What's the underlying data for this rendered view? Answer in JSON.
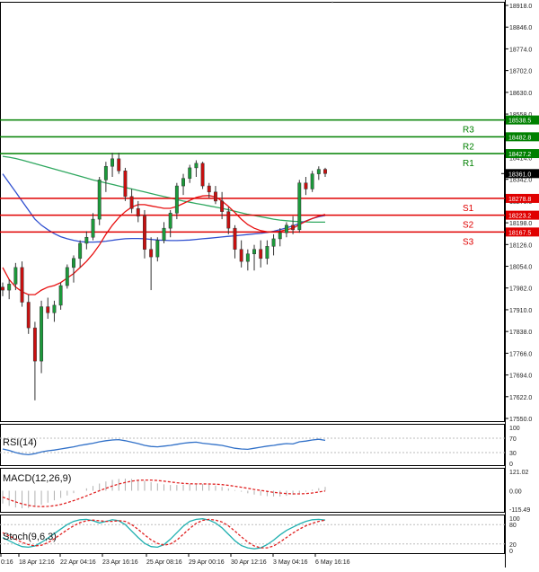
{
  "chart_data": {
    "type": "candlestick",
    "price_axis": {
      "ticks": [
        "18918.0",
        "18846.0",
        "18774.0",
        "18702.0",
        "18630.0",
        "18558.0",
        "18486.0",
        "18414.0",
        "18342.0",
        "18270.0",
        "18198.0",
        "18126.0",
        "18054.0",
        "17982.0",
        "17910.0",
        "17838.0",
        "17766.0",
        "17694.0",
        "17622.0",
        "17550.0"
      ],
      "tick_values": [
        18918,
        18846,
        18774,
        18702,
        18630,
        18558,
        18486,
        18414,
        18342,
        18270,
        18198,
        18126,
        18054,
        17982,
        17910,
        17838,
        17766,
        17694,
        17622,
        17550
      ],
      "range": [
        17550,
        18918
      ]
    },
    "time_axis": {
      "labels": [
        "0:16",
        "18 Apr 12:16",
        "22 Apr 04:16",
        "23 Apr 16:16",
        "25 Apr 08:16",
        "29 Apr 00:16",
        "30 Apr 12:16",
        "3 May 04:16",
        "6 May 16:16"
      ]
    },
    "levels": [
      {
        "name": "R3",
        "value": 18538.5,
        "label": "18538.5",
        "color": "#008000"
      },
      {
        "name": "R2",
        "value": 18482.8,
        "label": "18482.8",
        "color": "#008000"
      },
      {
        "name": "R1",
        "value": 18427.2,
        "label": "18427.2",
        "color": "#008000"
      },
      {
        "name": "S1",
        "value": 18278.8,
        "label": "18278.8",
        "color": "#e00000"
      },
      {
        "name": "S2",
        "value": 18223.2,
        "label": "18223.2",
        "color": "#e00000"
      },
      {
        "name": "S3",
        "value": 18167.5,
        "label": "18167.5",
        "color": "#e00000"
      }
    ],
    "current_price": {
      "value": 18361.0,
      "label": "18361.0"
    },
    "candles": [
      {
        "o": 17985,
        "h": 18000,
        "l": 17955,
        "c": 17975
      },
      {
        "o": 17975,
        "h": 18010,
        "l": 17945,
        "c": 17995
      },
      {
        "o": 17995,
        "h": 18065,
        "l": 17975,
        "c": 18050
      },
      {
        "o": 18050,
        "h": 18070,
        "l": 17920,
        "c": 17935
      },
      {
        "o": 17935,
        "h": 17960,
        "l": 17830,
        "c": 17850
      },
      {
        "o": 17850,
        "h": 17870,
        "l": 17610,
        "c": 17740
      },
      {
        "o": 17740,
        "h": 17940,
        "l": 17700,
        "c": 17920
      },
      {
        "o": 17920,
        "h": 17950,
        "l": 17880,
        "c": 17900
      },
      {
        "o": 17900,
        "h": 17940,
        "l": 17870,
        "c": 17925
      },
      {
        "o": 17925,
        "h": 18000,
        "l": 17910,
        "c": 17990
      },
      {
        "o": 17990,
        "h": 18060,
        "l": 17980,
        "c": 18050
      },
      {
        "o": 18050,
        "h": 18090,
        "l": 18000,
        "c": 18080
      },
      {
        "o": 18080,
        "h": 18140,
        "l": 18050,
        "c": 18130
      },
      {
        "o": 18130,
        "h": 18170,
        "l": 18110,
        "c": 18150
      },
      {
        "o": 18150,
        "h": 18230,
        "l": 18140,
        "c": 18210
      },
      {
        "o": 18210,
        "h": 18350,
        "l": 18190,
        "c": 18340
      },
      {
        "o": 18340,
        "h": 18400,
        "l": 18300,
        "c": 18385
      },
      {
        "o": 18385,
        "h": 18430,
        "l": 18350,
        "c": 18410
      },
      {
        "o": 18410,
        "h": 18430,
        "l": 18360,
        "c": 18370
      },
      {
        "o": 18370,
        "h": 18380,
        "l": 18270,
        "c": 18285
      },
      {
        "o": 18285,
        "h": 18310,
        "l": 18230,
        "c": 18245
      },
      {
        "o": 18245,
        "h": 18270,
        "l": 18200,
        "c": 18220
      },
      {
        "o": 18220,
        "h": 18240,
        "l": 18080,
        "c": 18110
      },
      {
        "o": 18110,
        "h": 18150,
        "l": 17975,
        "c": 18085
      },
      {
        "o": 18085,
        "h": 18150,
        "l": 18070,
        "c": 18140
      },
      {
        "o": 18140,
        "h": 18200,
        "l": 18130,
        "c": 18180
      },
      {
        "o": 18180,
        "h": 18240,
        "l": 18150,
        "c": 18230
      },
      {
        "o": 18230,
        "h": 18330,
        "l": 18210,
        "c": 18320
      },
      {
        "o": 18320,
        "h": 18360,
        "l": 18290,
        "c": 18345
      },
      {
        "o": 18345,
        "h": 18390,
        "l": 18330,
        "c": 18380
      },
      {
        "o": 18380,
        "h": 18405,
        "l": 18350,
        "c": 18395
      },
      {
        "o": 18395,
        "h": 18400,
        "l": 18310,
        "c": 18320
      },
      {
        "o": 18320,
        "h": 18330,
        "l": 18280,
        "c": 18300
      },
      {
        "o": 18300,
        "h": 18320,
        "l": 18260,
        "c": 18270
      },
      {
        "o": 18270,
        "h": 18300,
        "l": 18210,
        "c": 18235
      },
      {
        "o": 18235,
        "h": 18250,
        "l": 18160,
        "c": 18180
      },
      {
        "o": 18180,
        "h": 18190,
        "l": 18080,
        "c": 18110
      },
      {
        "o": 18110,
        "h": 18140,
        "l": 18050,
        "c": 18070
      },
      {
        "o": 18070,
        "h": 18110,
        "l": 18040,
        "c": 18095
      },
      {
        "o": 18095,
        "h": 18125,
        "l": 18040,
        "c": 18110
      },
      {
        "o": 18110,
        "h": 18140,
        "l": 18050,
        "c": 18080
      },
      {
        "o": 18080,
        "h": 18140,
        "l": 18060,
        "c": 18120
      },
      {
        "o": 18120,
        "h": 18160,
        "l": 18090,
        "c": 18145
      },
      {
        "o": 18145,
        "h": 18180,
        "l": 18120,
        "c": 18165
      },
      {
        "o": 18165,
        "h": 18200,
        "l": 18150,
        "c": 18190
      },
      {
        "o": 18190,
        "h": 18220,
        "l": 18160,
        "c": 18175
      },
      {
        "o": 18175,
        "h": 18340,
        "l": 18165,
        "c": 18330
      },
      {
        "o": 18330,
        "h": 18350,
        "l": 18290,
        "c": 18310
      },
      {
        "o": 18310,
        "h": 18370,
        "l": 18300,
        "c": 18360
      },
      {
        "o": 18360,
        "h": 18385,
        "l": 18340,
        "c": 18375
      },
      {
        "o": 18375,
        "h": 18380,
        "l": 18350,
        "c": 18361
      }
    ],
    "ma_fast": {
      "color": "#e81010",
      "values": [
        18050,
        18010,
        17985,
        17970,
        17960,
        17960,
        17975,
        17985,
        17990,
        18000,
        18015,
        18030,
        18050,
        18070,
        18095,
        18125,
        18160,
        18190,
        18215,
        18235,
        18250,
        18258,
        18258,
        18254,
        18250,
        18246,
        18246,
        18252,
        18262,
        18272,
        18282,
        18287,
        18288,
        18284,
        18270,
        18252,
        18232,
        18210,
        18192,
        18180,
        18172,
        18168,
        18168,
        18170,
        18175,
        18180,
        18192,
        18203,
        18212,
        18220,
        18226
      ]
    },
    "ma_mid": {
      "color": "#3050d0",
      "values": [
        18360,
        18330,
        18300,
        18270,
        18240,
        18210,
        18190,
        18175,
        18162,
        18152,
        18145,
        18140,
        18136,
        18134,
        18134,
        18135,
        18137,
        18140,
        18143,
        18145,
        18146,
        18146,
        18145,
        18143,
        18141,
        18140,
        18139,
        18139,
        18140,
        18141,
        18143,
        18145,
        18147,
        18149,
        18151,
        18153,
        18155,
        18157,
        18159,
        18161,
        18163,
        18166,
        18170,
        18175,
        18181,
        18188,
        18196,
        18204,
        18212,
        18218,
        18222
      ]
    },
    "ma_slow": {
      "color": "#30a860",
      "values": [
        18418,
        18415,
        18411,
        18406,
        18400,
        18394,
        18388,
        18382,
        18376,
        18370,
        18364,
        18358,
        18352,
        18346,
        18340,
        18335,
        18330,
        18325,
        18320,
        18315,
        18310,
        18305,
        18300,
        18295,
        18290,
        18285,
        18280,
        18275,
        18270,
        18266,
        18262,
        18258,
        18254,
        18250,
        18246,
        18241,
        18236,
        18231,
        18226,
        18222,
        18218,
        18214,
        18210,
        18207,
        18205,
        18203,
        18202,
        18201,
        18200,
        18200,
        18200
      ]
    },
    "rsi": {
      "label": "RSI(14)",
      "ticks": [
        "100",
        "70",
        "30",
        "0"
      ],
      "tick_values": [
        100,
        70,
        30,
        0
      ],
      "color": "#3070c8",
      "values": [
        40,
        36,
        30,
        26,
        24,
        27,
        32,
        35,
        37,
        40,
        43,
        46,
        50,
        53,
        56,
        60,
        63,
        65,
        66,
        63,
        59,
        55,
        50,
        47,
        46,
        48,
        50,
        53,
        56,
        58,
        59,
        56,
        54,
        52,
        50,
        46,
        42,
        40,
        39,
        42,
        45,
        48,
        50,
        53,
        55,
        54,
        60,
        62,
        65,
        67,
        64
      ]
    },
    "macd": {
      "label": "MACD(12,26,9)",
      "ticks": [
        "121.02",
        "0.00",
        "-115.49"
      ],
      "tick_values": [
        121.02,
        0,
        -115.49
      ],
      "hist_color": "#b0b0b0",
      "signal_color": "#e02020",
      "hist": [
        -80,
        -95,
        -105,
        -110,
        -108,
        -100,
        -88,
        -75,
        -60,
        -45,
        -30,
        -15,
        0,
        15,
        30,
        45,
        58,
        68,
        74,
        76,
        74,
        70,
        62,
        54,
        46,
        40,
        36,
        36,
        38,
        42,
        44,
        42,
        38,
        32,
        24,
        14,
        4,
        -6,
        -16,
        -24,
        -30,
        -34,
        -36,
        -36,
        -32,
        -26,
        -16,
        -6,
        6,
        16,
        24
      ],
      "signal": [
        -40,
        -55,
        -70,
        -82,
        -92,
        -98,
        -100,
        -98,
        -94,
        -86,
        -75,
        -62,
        -48,
        -32,
        -16,
        0,
        15,
        30,
        42,
        52,
        60,
        65,
        67,
        67,
        64,
        60,
        55,
        50,
        46,
        44,
        43,
        43,
        42,
        41,
        38,
        34,
        28,
        22,
        15,
        8,
        2,
        -4,
        -10,
        -14,
        -18,
        -20,
        -20,
        -18,
        -14,
        -8,
        -2
      ]
    },
    "stoch": {
      "label": "Stoch(9,6,3)",
      "ticks": [
        "100",
        "80",
        "20",
        "0"
      ],
      "tick_values": [
        100,
        80,
        20,
        0
      ],
      "k_color": "#20b0b0",
      "d_color": "#e02020",
      "k": [
        40,
        30,
        20,
        12,
        10,
        14,
        25,
        38,
        52,
        66,
        80,
        90,
        95,
        96,
        92,
        85,
        90,
        95,
        92,
        80,
        60,
        40,
        22,
        12,
        10,
        18,
        35,
        55,
        75,
        90,
        96,
        98,
        94,
        85,
        70,
        50,
        30,
        15,
        8,
        5,
        8,
        18,
        32,
        48,
        62,
        72,
        82,
        90,
        95,
        96,
        94
      ],
      "d": [
        55,
        45,
        35,
        25,
        18,
        14,
        16,
        24,
        36,
        50,
        64,
        76,
        86,
        92,
        94,
        92,
        90,
        90,
        92,
        90,
        80,
        65,
        48,
        33,
        22,
        16,
        20,
        32,
        50,
        68,
        84,
        93,
        96,
        94,
        88,
        76,
        60,
        42,
        26,
        14,
        8,
        8,
        14,
        26,
        40,
        54,
        66,
        76,
        84,
        90,
        94
      ]
    }
  }
}
